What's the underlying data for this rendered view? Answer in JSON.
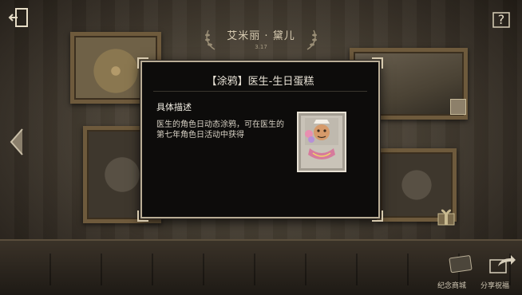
{
  "header": {
    "character_name": "艾米丽 · 黛儿",
    "date": "3.17"
  },
  "dialog": {
    "title": "【涂鸦】医生-生日蛋糕",
    "section_heading": "具体描述",
    "description": "医生的角色日动态涂鸦，可在医生的第七年角色日活动中获得",
    "item_icon": "monkey-cake-graffiti-icon"
  },
  "footer": {
    "souvenir_label": "纪念商城",
    "share_label": "分享祝福"
  },
  "icons": {
    "exit": "exit-door-icon",
    "help": "help-question-icon",
    "prev": "left-arrow-icon",
    "gift": "gift-box-icon",
    "souvenir": "ticket-icon",
    "share": "share-arrow-icon"
  },
  "colors": {
    "dialog_bg": "#0d0c0b",
    "dialog_border": "#b9ad96",
    "text": "#e8e2d6"
  }
}
